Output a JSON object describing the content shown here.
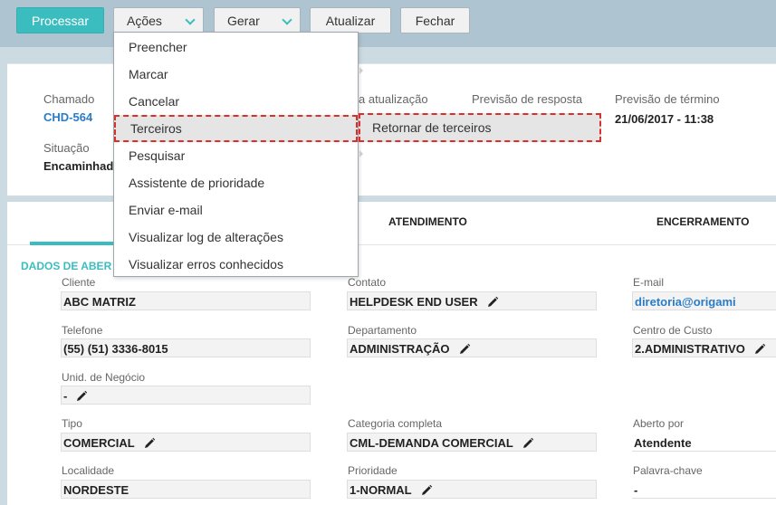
{
  "toolbar": {
    "processar": "Processar",
    "acoes": "Ações",
    "gerar": "Gerar",
    "atualizar": "Atualizar",
    "fechar": "Fechar"
  },
  "header": {
    "chamado_label": "Chamado",
    "chamado_value": "CHD-564",
    "ultima_atualizacao_label": "a atualização",
    "previsao_resposta_label": "Previsão de resposta",
    "previsao_termino_label": "Previsão de término",
    "previsao_termino_value": "21/06/2017 - 11:38",
    "situacao_label": "Situação",
    "situacao_value": "Encaminhad"
  },
  "tabs": {
    "atendimento": "ATENDIMENTO",
    "encerramento": "ENCERRAMENTO"
  },
  "section": {
    "title": "DADOS DE ABER"
  },
  "fields": {
    "cliente_label": "Cliente",
    "cliente_value": "ABC MATRIZ",
    "contato_label": "Contato",
    "contato_value": "HELPDESK END USER",
    "email_label": "E-mail",
    "email_value": "diretoria@origami",
    "telefone_label": "Telefone",
    "telefone_value": "(55) (51) 3336-8015",
    "departamento_label": "Departamento",
    "departamento_value": "ADMINISTRAÇÃO",
    "centro_label": "Centro de Custo",
    "centro_value": "2.ADMINISTRATIVO",
    "unid_label": "Unid. de Negócio",
    "unid_value": "-",
    "tipo_label": "Tipo",
    "tipo_value": "COMERCIAL",
    "categoria_label": "Categoria completa",
    "categoria_value": "CML-DEMANDA COMERCIAL",
    "aberto_label": "Aberto por",
    "aberto_value": "Atendente",
    "localidade_label": "Localidade",
    "localidade_value": "NORDESTE",
    "prioridade_label": "Prioridade",
    "prioridade_value": "1-NORMAL",
    "palavra_label": "Palavra-chave",
    "palavra_value": "-"
  },
  "dropdown": {
    "items": [
      "Preencher",
      "Marcar",
      "Cancelar",
      "Terceiros",
      "Pesquisar",
      "Assistente de prioridade",
      "Enviar e-mail",
      "Visualizar log de alterações",
      "Visualizar erros conhecidos"
    ],
    "highlighted_index": 3
  },
  "submenu": {
    "item": "Retornar de terceiros"
  },
  "colors": {
    "accent": "#3bbdc0",
    "link": "#2a7cc7",
    "highlight_border": "#d9302c",
    "topbar": "#aec4d0"
  }
}
